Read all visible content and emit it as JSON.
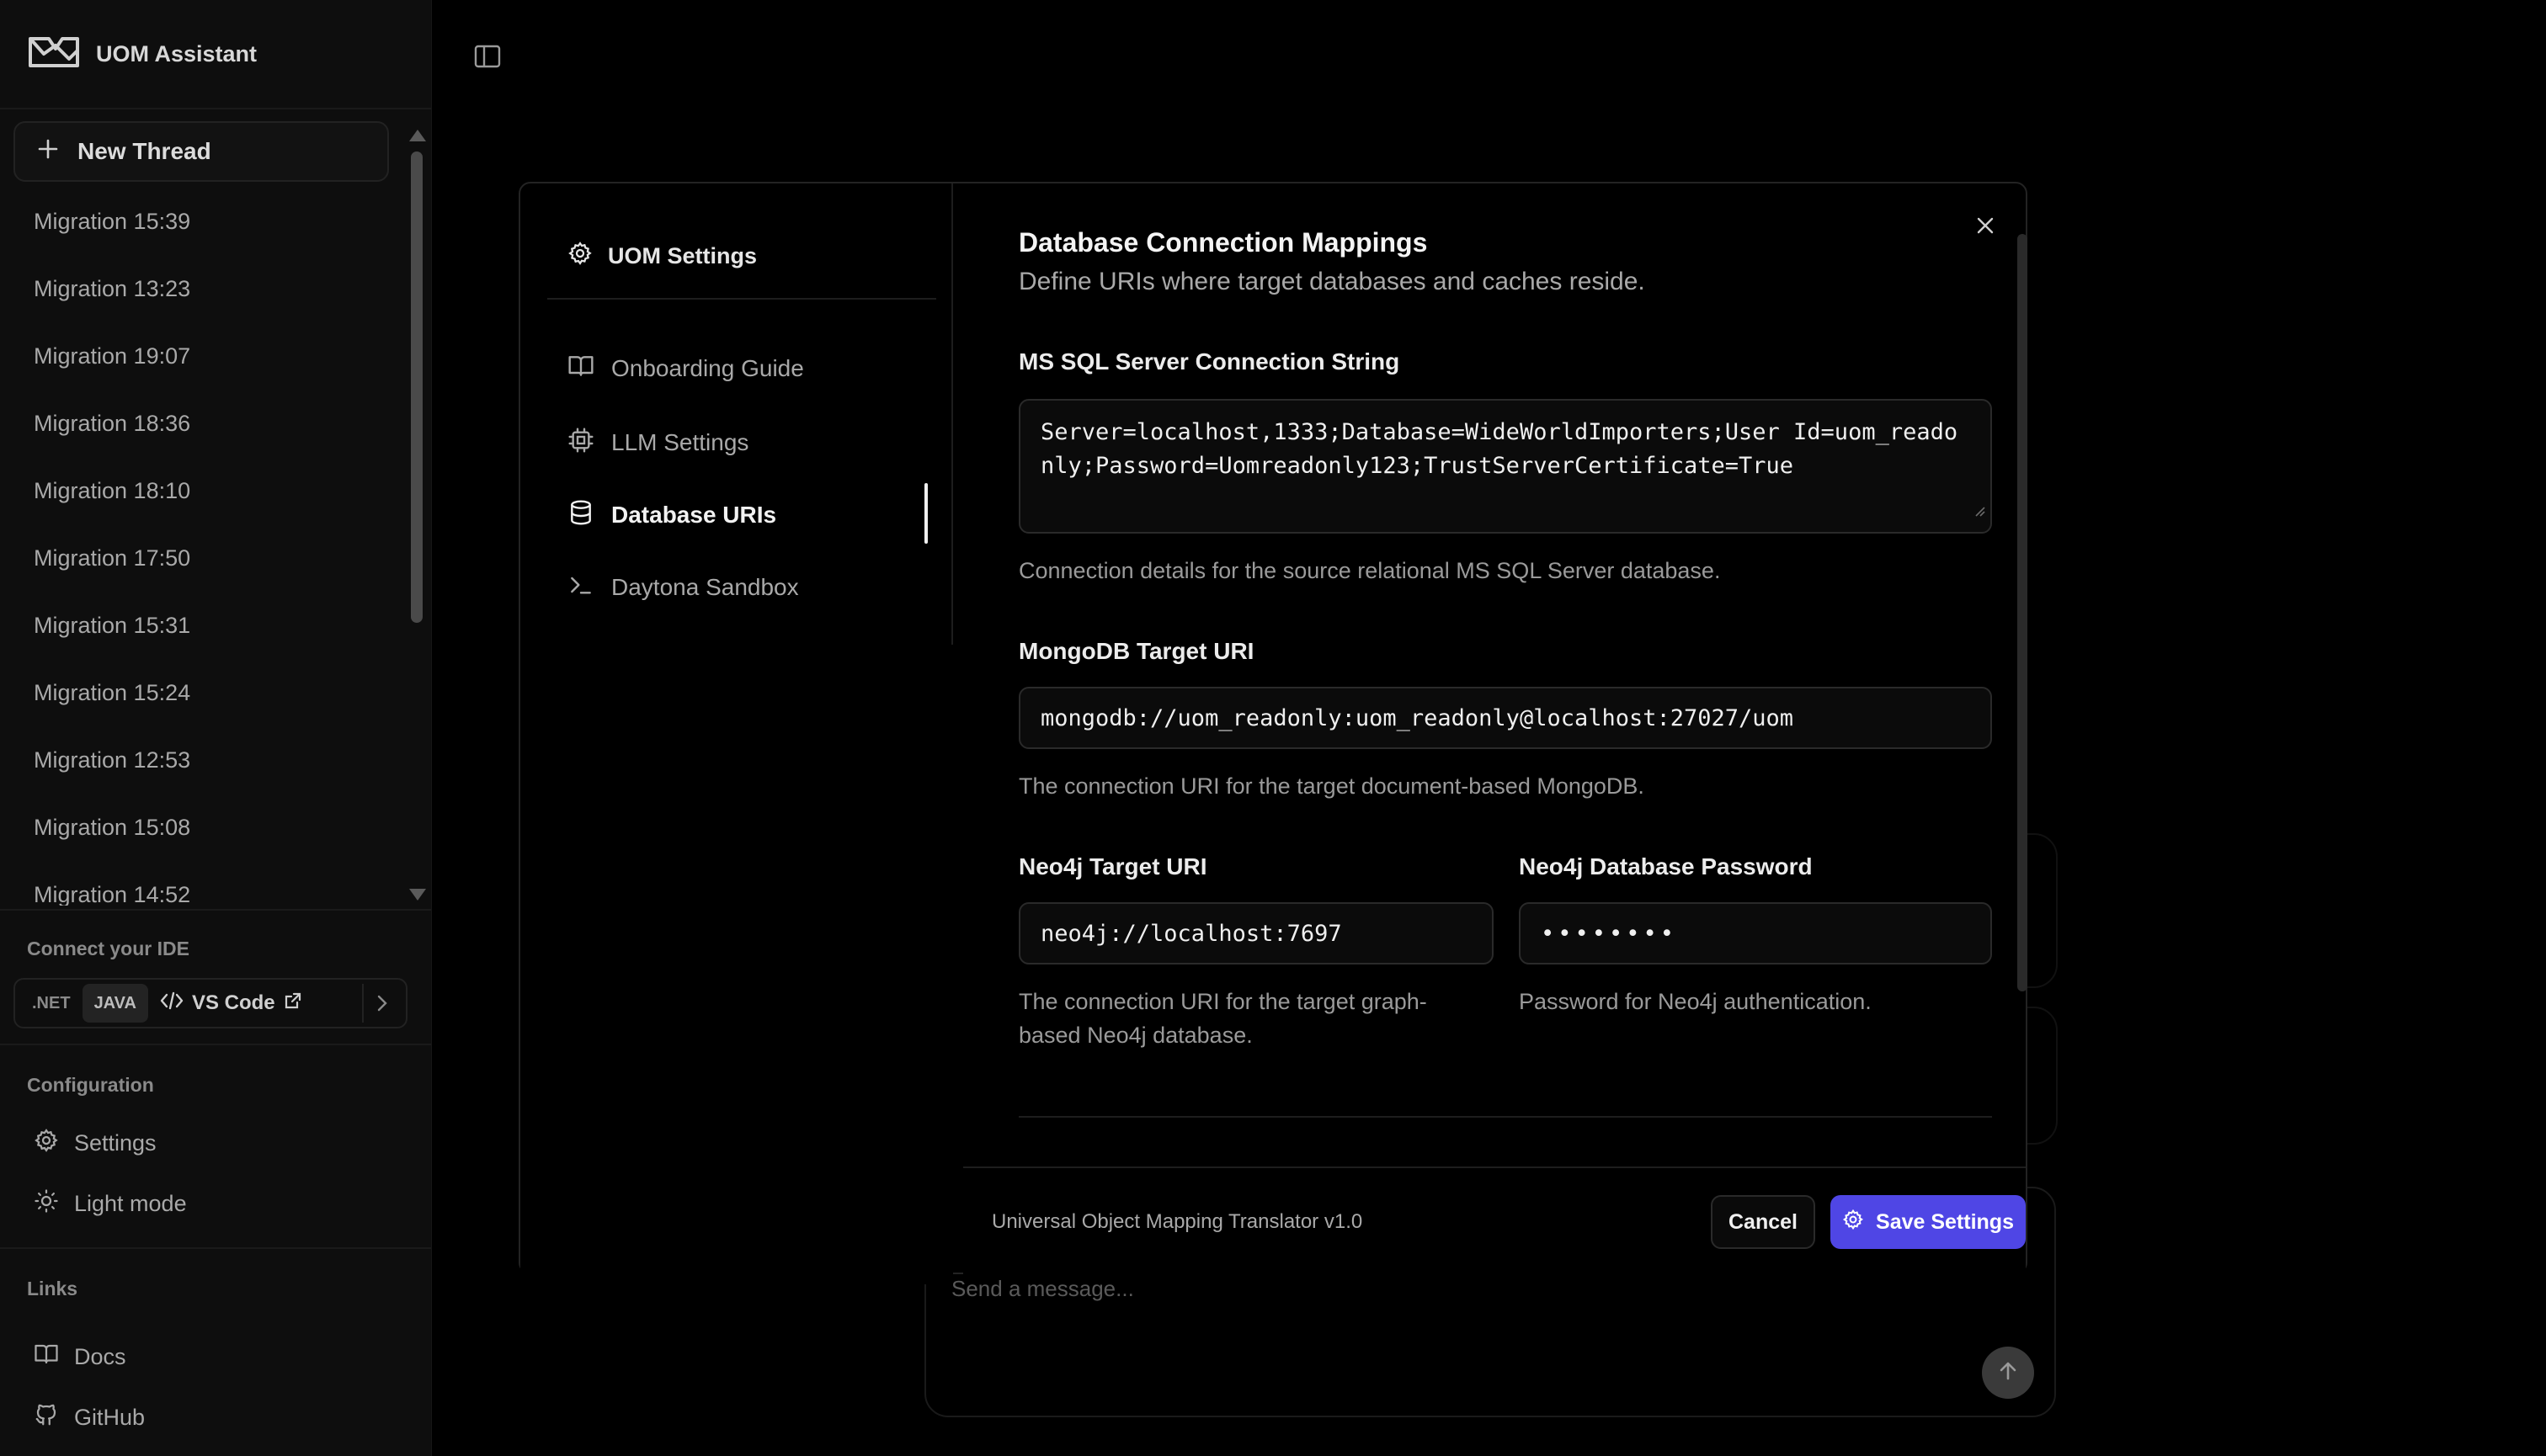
{
  "app": {
    "title": "UOM Assistant"
  },
  "sidebar": {
    "new_thread_label": "New Thread",
    "threads": [
      "Migration 15:39",
      "Migration 13:23",
      "Migration 19:07",
      "Migration 18:36",
      "Migration 18:10",
      "Migration 17:50",
      "Migration 15:31",
      "Migration 15:24",
      "Migration 12:53",
      "Migration 15:08",
      "Migration 14:52"
    ],
    "ide": {
      "heading": "Connect your IDE",
      "options": [
        ".NET",
        "JAVA"
      ],
      "active_option": "JAVA",
      "vscode_label": "VS Code"
    },
    "configuration": {
      "heading": "Configuration",
      "settings_label": "Settings",
      "light_mode_label": "Light mode"
    },
    "links": {
      "heading": "Links",
      "docs_label": "Docs",
      "github_label": "GitHub"
    }
  },
  "chat": {
    "composer_placeholder": "Send a message..."
  },
  "modal": {
    "nav": {
      "title": "UOM Settings",
      "items": [
        {
          "label": "Onboarding Guide",
          "icon": "book-icon"
        },
        {
          "label": "LLM Settings",
          "icon": "cpu-icon"
        },
        {
          "label": "Database URIs",
          "icon": "database-icon"
        },
        {
          "label": "Daytona Sandbox",
          "icon": "terminal-icon"
        }
      ],
      "active": "Database URIs"
    },
    "section": {
      "title": "Database Connection Mappings",
      "subtitle": "Define URIs where target databases and caches reside."
    },
    "fields": {
      "mssql": {
        "label": "MS SQL Server Connection String",
        "value": "Server=localhost,1333;Database=WideWorldImporters;User Id=uom_readonly;Password=Uomreadonly123;TrustServerCertificate=True",
        "help": "Connection details for the source relational MS SQL Server database."
      },
      "mongodb": {
        "label": "MongoDB Target URI",
        "value": "mongodb://uom_readonly:uom_readonly@localhost:27027/uom",
        "help": "The connection URI for the target document-based MongoDB."
      },
      "neo4j_uri": {
        "label": "Neo4j Target URI",
        "value": "neo4j://localhost:7697",
        "help": "The connection URI for the target graph-based Neo4j database."
      },
      "neo4j_password": {
        "label": "Neo4j Database Password",
        "value": "••••••••",
        "help": "Password for Neo4j authentication."
      }
    },
    "footer": {
      "version": "Universal Object Mapping Translator v1.0",
      "cancel_label": "Cancel",
      "save_label": "Save Settings"
    }
  },
  "colors": {
    "background": "#000000",
    "sidebar": "#0e0e0e",
    "accent": "#4f46e5"
  }
}
